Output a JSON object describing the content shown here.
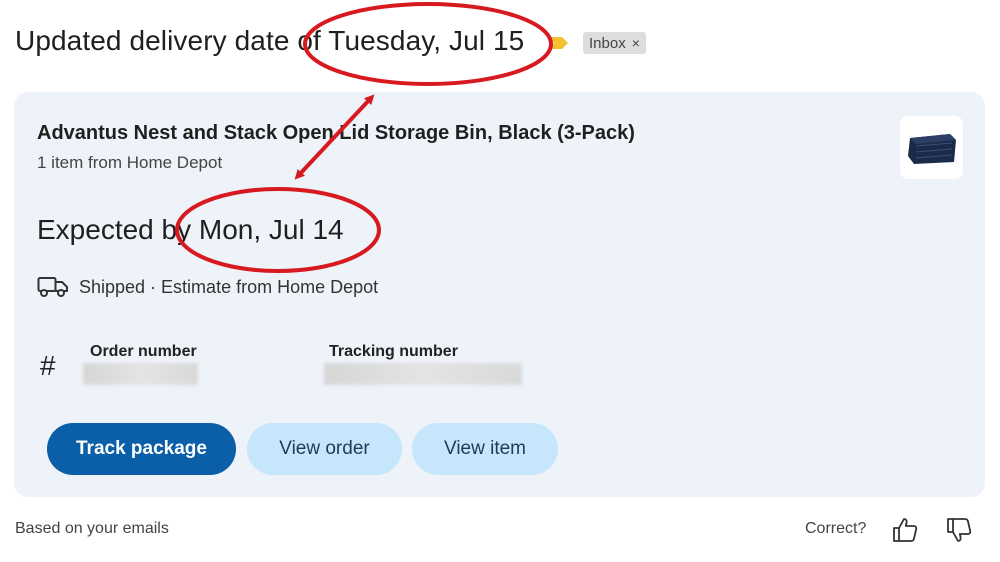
{
  "email": {
    "subject": "Updated delivery date of Tuesday, Jul 15",
    "label_chip": "Inbox",
    "label_close": "×"
  },
  "card": {
    "product_title": "Advantus Nest and Stack Open Lid Storage Bin, Black (3-Pack)",
    "product_sub": "1 item from Home Depot",
    "expected": "Expected by Mon, Jul 14",
    "shipping_status": "Shipped · Estimate from Home Depot",
    "hash_symbol": "#",
    "order_number_label": "Order number",
    "tracking_number_label": "Tracking number",
    "buttons": {
      "track": "Track package",
      "view_order": "View order",
      "view_item": "View item"
    }
  },
  "footer": {
    "based_on": "Based on your emails",
    "correct_prompt": "Correct?"
  },
  "icons": {
    "importance": "importance-marker-icon",
    "truck": "truck-icon",
    "thumbs_up": "thumbs-up-icon",
    "thumbs_down": "thumbs-down-icon"
  },
  "colors": {
    "card_bg": "#eef2f9",
    "primary_button": "#0b5ea8",
    "secondary_button": "#c6e6fb",
    "annotation_red": "#d71920",
    "importance_yellow": "#f2c230"
  }
}
